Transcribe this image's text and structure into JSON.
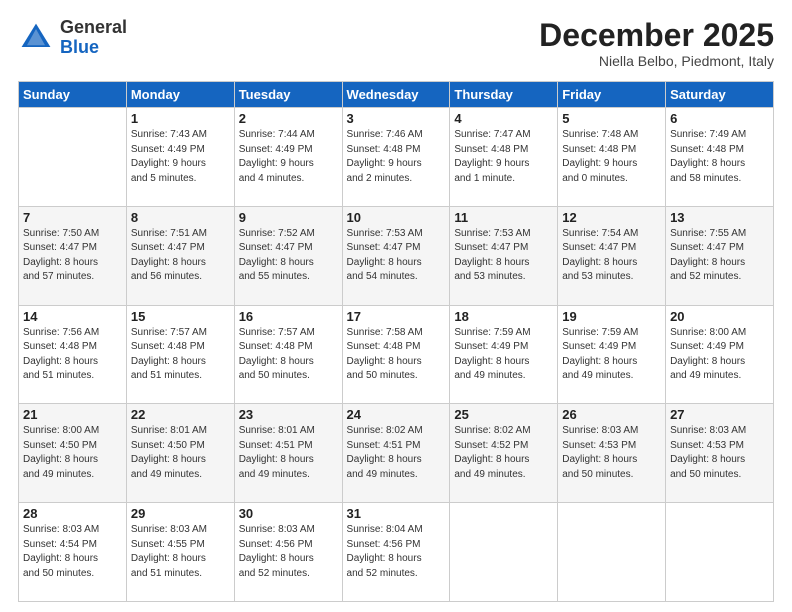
{
  "logo": {
    "general": "General",
    "blue": "Blue"
  },
  "header": {
    "month": "December 2025",
    "location": "Niella Belbo, Piedmont, Italy"
  },
  "days_of_week": [
    "Sunday",
    "Monday",
    "Tuesday",
    "Wednesday",
    "Thursday",
    "Friday",
    "Saturday"
  ],
  "weeks": [
    [
      {
        "day": "",
        "info": ""
      },
      {
        "day": "1",
        "info": "Sunrise: 7:43 AM\nSunset: 4:49 PM\nDaylight: 9 hours\nand 5 minutes."
      },
      {
        "day": "2",
        "info": "Sunrise: 7:44 AM\nSunset: 4:49 PM\nDaylight: 9 hours\nand 4 minutes."
      },
      {
        "day": "3",
        "info": "Sunrise: 7:46 AM\nSunset: 4:48 PM\nDaylight: 9 hours\nand 2 minutes."
      },
      {
        "day": "4",
        "info": "Sunrise: 7:47 AM\nSunset: 4:48 PM\nDaylight: 9 hours\nand 1 minute."
      },
      {
        "day": "5",
        "info": "Sunrise: 7:48 AM\nSunset: 4:48 PM\nDaylight: 9 hours\nand 0 minutes."
      },
      {
        "day": "6",
        "info": "Sunrise: 7:49 AM\nSunset: 4:48 PM\nDaylight: 8 hours\nand 58 minutes."
      }
    ],
    [
      {
        "day": "7",
        "info": "Sunrise: 7:50 AM\nSunset: 4:47 PM\nDaylight: 8 hours\nand 57 minutes."
      },
      {
        "day": "8",
        "info": "Sunrise: 7:51 AM\nSunset: 4:47 PM\nDaylight: 8 hours\nand 56 minutes."
      },
      {
        "day": "9",
        "info": "Sunrise: 7:52 AM\nSunset: 4:47 PM\nDaylight: 8 hours\nand 55 minutes."
      },
      {
        "day": "10",
        "info": "Sunrise: 7:53 AM\nSunset: 4:47 PM\nDaylight: 8 hours\nand 54 minutes."
      },
      {
        "day": "11",
        "info": "Sunrise: 7:53 AM\nSunset: 4:47 PM\nDaylight: 8 hours\nand 53 minutes."
      },
      {
        "day": "12",
        "info": "Sunrise: 7:54 AM\nSunset: 4:47 PM\nDaylight: 8 hours\nand 53 minutes."
      },
      {
        "day": "13",
        "info": "Sunrise: 7:55 AM\nSunset: 4:47 PM\nDaylight: 8 hours\nand 52 minutes."
      }
    ],
    [
      {
        "day": "14",
        "info": "Sunrise: 7:56 AM\nSunset: 4:48 PM\nDaylight: 8 hours\nand 51 minutes."
      },
      {
        "day": "15",
        "info": "Sunrise: 7:57 AM\nSunset: 4:48 PM\nDaylight: 8 hours\nand 51 minutes."
      },
      {
        "day": "16",
        "info": "Sunrise: 7:57 AM\nSunset: 4:48 PM\nDaylight: 8 hours\nand 50 minutes."
      },
      {
        "day": "17",
        "info": "Sunrise: 7:58 AM\nSunset: 4:48 PM\nDaylight: 8 hours\nand 50 minutes."
      },
      {
        "day": "18",
        "info": "Sunrise: 7:59 AM\nSunset: 4:49 PM\nDaylight: 8 hours\nand 49 minutes."
      },
      {
        "day": "19",
        "info": "Sunrise: 7:59 AM\nSunset: 4:49 PM\nDaylight: 8 hours\nand 49 minutes."
      },
      {
        "day": "20",
        "info": "Sunrise: 8:00 AM\nSunset: 4:49 PM\nDaylight: 8 hours\nand 49 minutes."
      }
    ],
    [
      {
        "day": "21",
        "info": "Sunrise: 8:00 AM\nSunset: 4:50 PM\nDaylight: 8 hours\nand 49 minutes."
      },
      {
        "day": "22",
        "info": "Sunrise: 8:01 AM\nSunset: 4:50 PM\nDaylight: 8 hours\nand 49 minutes."
      },
      {
        "day": "23",
        "info": "Sunrise: 8:01 AM\nSunset: 4:51 PM\nDaylight: 8 hours\nand 49 minutes."
      },
      {
        "day": "24",
        "info": "Sunrise: 8:02 AM\nSunset: 4:51 PM\nDaylight: 8 hours\nand 49 minutes."
      },
      {
        "day": "25",
        "info": "Sunrise: 8:02 AM\nSunset: 4:52 PM\nDaylight: 8 hours\nand 49 minutes."
      },
      {
        "day": "26",
        "info": "Sunrise: 8:03 AM\nSunset: 4:53 PM\nDaylight: 8 hours\nand 50 minutes."
      },
      {
        "day": "27",
        "info": "Sunrise: 8:03 AM\nSunset: 4:53 PM\nDaylight: 8 hours\nand 50 minutes."
      }
    ],
    [
      {
        "day": "28",
        "info": "Sunrise: 8:03 AM\nSunset: 4:54 PM\nDaylight: 8 hours\nand 50 minutes."
      },
      {
        "day": "29",
        "info": "Sunrise: 8:03 AM\nSunset: 4:55 PM\nDaylight: 8 hours\nand 51 minutes."
      },
      {
        "day": "30",
        "info": "Sunrise: 8:03 AM\nSunset: 4:56 PM\nDaylight: 8 hours\nand 52 minutes."
      },
      {
        "day": "31",
        "info": "Sunrise: 8:04 AM\nSunset: 4:56 PM\nDaylight: 8 hours\nand 52 minutes."
      },
      {
        "day": "",
        "info": ""
      },
      {
        "day": "",
        "info": ""
      },
      {
        "day": "",
        "info": ""
      }
    ]
  ]
}
